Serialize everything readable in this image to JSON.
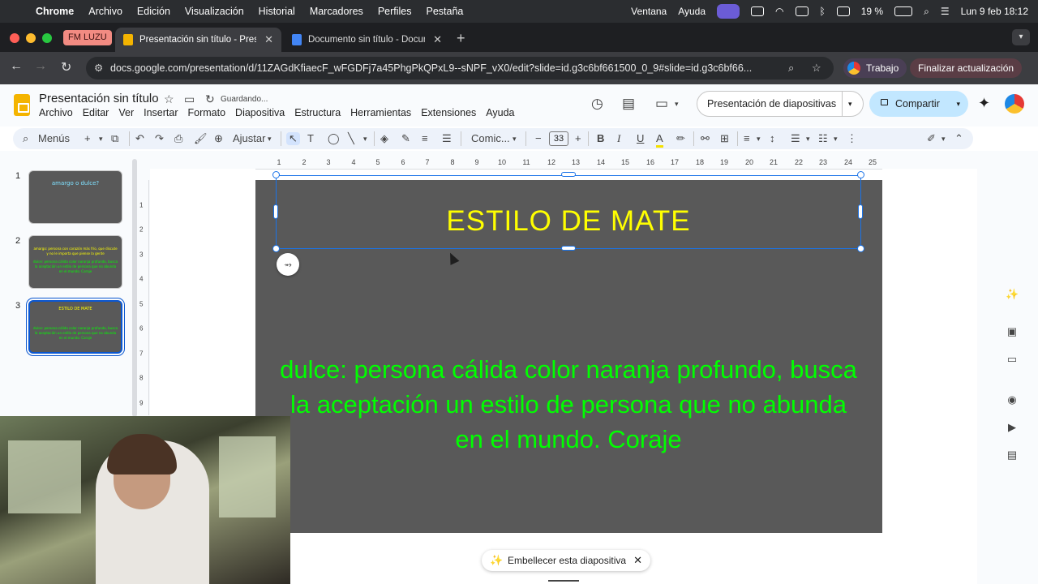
{
  "macbar": {
    "app": "Chrome",
    "menus": [
      "Archivo",
      "Edición",
      "Visualización",
      "Historial",
      "Marcadores",
      "Perfiles",
      "Pestaña"
    ],
    "right_menus": [
      "Ventana",
      "Ayuda"
    ],
    "battery": "19 %",
    "datetime": "Lun 9 feb  18:12"
  },
  "browser": {
    "tab_group": "FM LUZU",
    "tabs": [
      {
        "title": "Presentación sin título - Prese",
        "active": true,
        "color": "#f4b400"
      },
      {
        "title": "Documento sin título - Docum",
        "active": false,
        "color": "#4285f4"
      }
    ],
    "url": "docs.google.com/presentation/d/11ZAGdKfiaecF_wFGDFj7a45PhgPkQPxL9--sNPF_vX0/edit?slide=id.g3c6bf661500_0_9#slide=id.g3c6bf66...",
    "profile": "Trabajo",
    "update": "Finalizar actualización"
  },
  "app": {
    "title": "Presentación sin título",
    "saving": "Guardando...",
    "menus": [
      "Archivo",
      "Editar",
      "Ver",
      "Insertar",
      "Formato",
      "Diapositiva",
      "Estructura",
      "Herramientas",
      "Extensiones",
      "Ayuda"
    ],
    "present_label": "Presentación de diapositivas",
    "share_label": "Compartir"
  },
  "toolbar": {
    "menus_label": "Menús",
    "fit_label": "Ajustar",
    "font": "Comic...",
    "font_size": "33"
  },
  "ruler_h": [
    "1",
    "2",
    "3",
    "4",
    "5",
    "6",
    "7",
    "8",
    "9",
    "10",
    "11",
    "12",
    "13",
    "14",
    "15",
    "16",
    "17",
    "18",
    "19",
    "20",
    "21",
    "22",
    "23",
    "24",
    "25"
  ],
  "ruler_v": [
    "1",
    "2",
    "3",
    "4",
    "5",
    "6",
    "7",
    "8",
    "9"
  ],
  "filmstrip": [
    {
      "num": "1",
      "title": "amargo o dulce?",
      "body": ""
    },
    {
      "num": "2",
      "title": "amargo: persona con corazón más frío, que discute y no le importa que piense la gente",
      "body": "dulce: persona cálida color naranja profundo, busca la aceptación un estilo de persona que no abunda en el mundo. Coraje"
    },
    {
      "num": "3",
      "title": "ESTILO DE MATE",
      "body": "dulce: persona cálida color naranja profundo, busca la aceptación un estilo de persona que no abunda en el mundo. Coraje"
    }
  ],
  "slide": {
    "title": "ESTILO DE MATE",
    "body": "dulce: persona cálida color naranja profundo, busca la aceptación un estilo de persona que no abunda en el mundo. Coraje",
    "background": "#595959",
    "title_color": "#ffff00",
    "body_color": "#00ff00"
  },
  "beautify": {
    "label": "Embellecer esta diapositiva"
  }
}
